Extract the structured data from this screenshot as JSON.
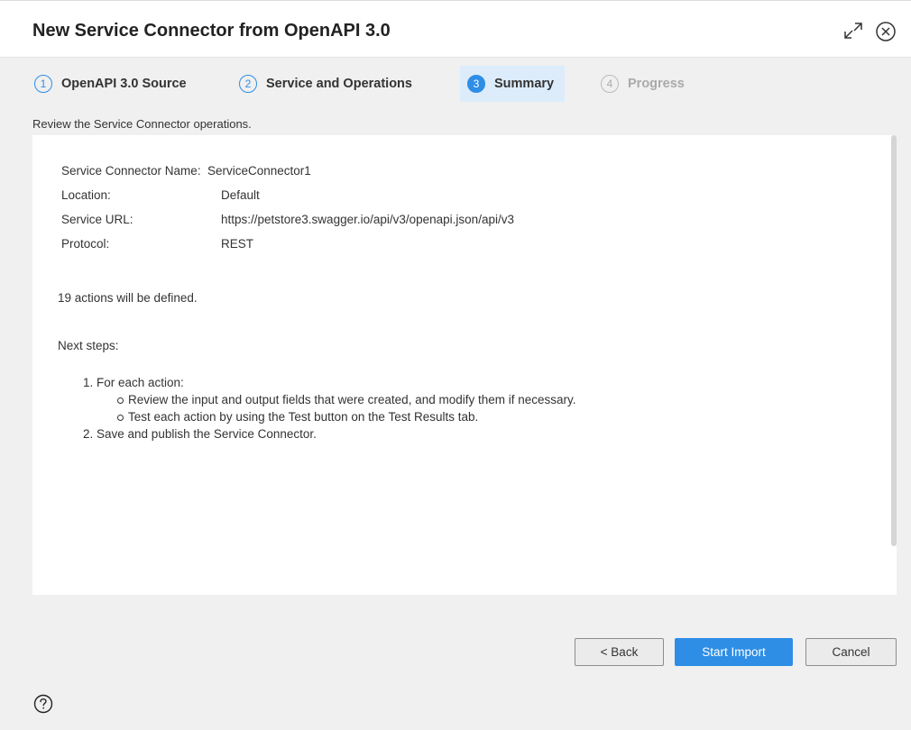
{
  "dialog": {
    "title": "New Service Connector from OpenAPI 3.0"
  },
  "icons": {
    "expand": "expand-icon",
    "close": "close-icon",
    "help": "help-icon"
  },
  "steps": [
    {
      "number": "1",
      "label": "OpenAPI 3.0 Source",
      "state": "complete"
    },
    {
      "number": "2",
      "label": "Service and Operations",
      "state": "complete"
    },
    {
      "number": "3",
      "label": "Summary",
      "state": "active"
    },
    {
      "number": "4",
      "label": "Progress",
      "state": "disabled"
    }
  ],
  "instruction": "Review the Service Connector operations.",
  "summary": {
    "fields": [
      {
        "label": "Service Connector Name:",
        "value": "ServiceConnector1"
      },
      {
        "label": "Location:",
        "value": "Default"
      },
      {
        "label": "Service URL:",
        "value": "https://petstore3.swagger.io/api/v3/openapi.json/api/v3"
      },
      {
        "label": "Protocol:",
        "value": "REST"
      }
    ],
    "actions_note": "19 actions will be defined.",
    "next_steps_heading": "Next steps:",
    "next_steps": [
      "1. For each action:",
      "Review the input and output fields that were created, and modify them if necessary.",
      "Test each action by using the Test button on the Test Results tab.",
      "2. Save and publish the Service Connector."
    ]
  },
  "buttons": {
    "back": "< Back",
    "start_import": "Start Import",
    "cancel": "Cancel"
  },
  "colors": {
    "accent": "#2e8ee6",
    "active_step_bg": "#dcecfb",
    "dialog_bg": "#f0f0f0"
  }
}
